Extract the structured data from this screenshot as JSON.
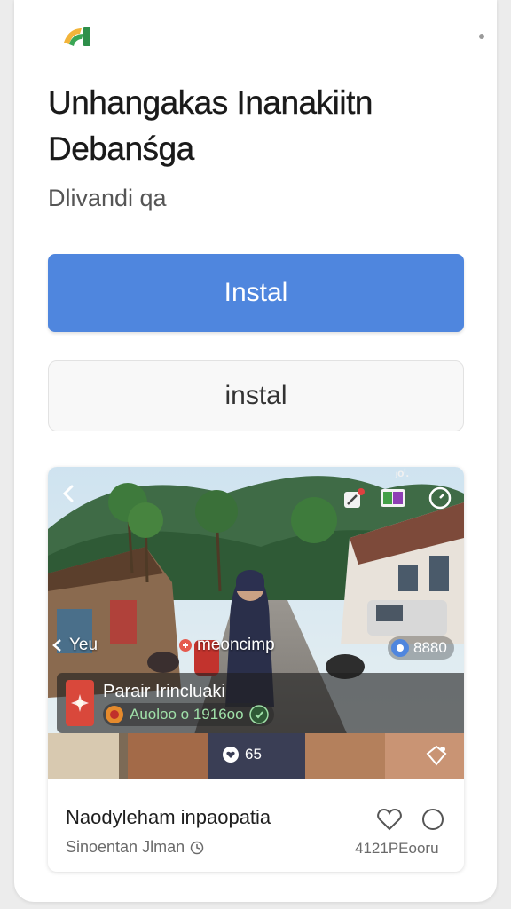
{
  "app": {
    "title": "Unhangakas Inanakiitn Debanśga",
    "subtitle": "Dlivandi qa",
    "accent_color": "#4f86de"
  },
  "buttons": {
    "primary_label": "Instal",
    "secondary_label": "instal"
  },
  "preview": {
    "corner_text": "ⱼoⁱ.",
    "back_icon": "chevron-left-icon",
    "left_chip": "Yeu",
    "mid_chip": "meoncimp",
    "right_chip": "8880",
    "app_name": "Parair Irincluaki",
    "app_meta": "Auoloo o 1916oo",
    "strip_chip": "65"
  },
  "listing": {
    "name": "Naodyleham inpaopatia",
    "developer": "Sinoentan Jlman",
    "count": "4121PEooru"
  }
}
